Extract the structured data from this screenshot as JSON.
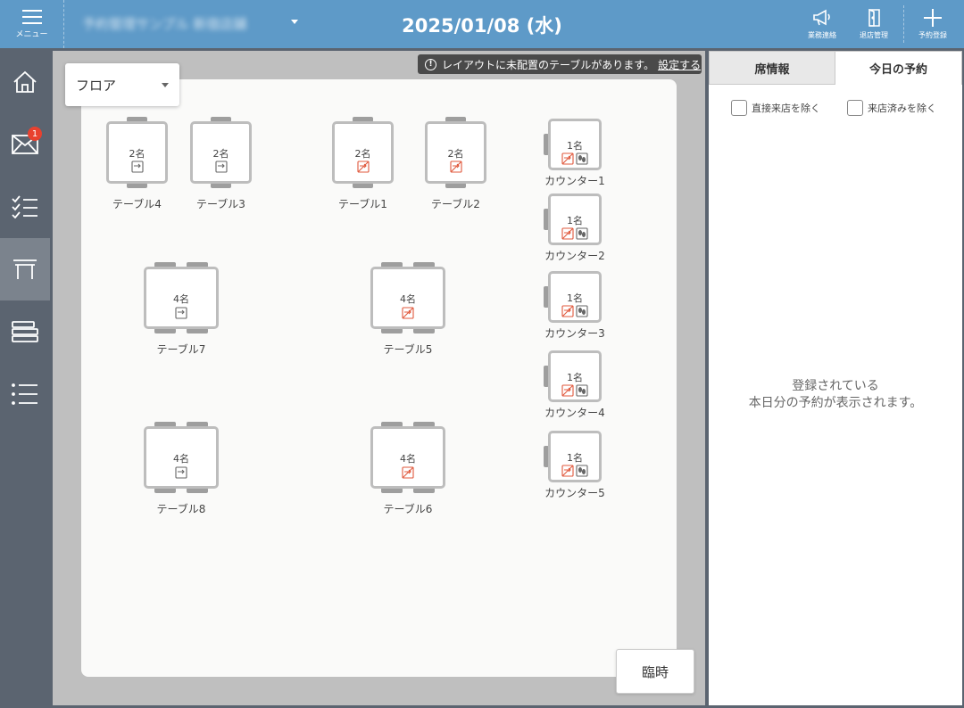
{
  "header": {
    "menu_label": "メニュー",
    "shop_name": "予約管理サンプル 新宿店舗",
    "date_title": "2025/01/08 (水)",
    "actions": [
      {
        "icon": "megaphone-icon",
        "label": "業務連絡"
      },
      {
        "icon": "exit-door-icon",
        "label": "退店管理"
      },
      {
        "icon": "plus-icon",
        "label": "予約登録"
      }
    ]
  },
  "sidebar": {
    "items": [
      {
        "icon": "home-icon"
      },
      {
        "icon": "mail-icon",
        "badge": "1"
      },
      {
        "icon": "checklist-icon"
      },
      {
        "icon": "table-icon",
        "active": true
      },
      {
        "icon": "layout-rows-icon"
      },
      {
        "icon": "list-icon"
      }
    ]
  },
  "floor": {
    "select_label": "フロア",
    "notice": "レイアウトに未配置のテーブルがあります。",
    "notice_link": "設定する",
    "temp_button": "臨時",
    "tables": [
      {
        "name": "テーブル4",
        "capacity": "2名",
        "kind": "t2",
        "icons": [
          "reserve"
        ]
      },
      {
        "name": "テーブル3",
        "capacity": "2名",
        "kind": "t2",
        "icons": [
          "reserve"
        ]
      },
      {
        "name": "テーブル1",
        "capacity": "2名",
        "kind": "t2",
        "icons": [
          "nores"
        ]
      },
      {
        "name": "テーブル2",
        "capacity": "2名",
        "kind": "t2",
        "icons": [
          "nores"
        ]
      },
      {
        "name": "カウンター1",
        "capacity": "1名",
        "kind": "counter",
        "icons": [
          "nores",
          "walkin"
        ]
      },
      {
        "name": "カウンター2",
        "capacity": "1名",
        "kind": "counter",
        "icons": [
          "nores",
          "walkin"
        ]
      },
      {
        "name": "テーブル7",
        "capacity": "4名",
        "kind": "t4",
        "icons": [
          "reserve"
        ]
      },
      {
        "name": "テーブル5",
        "capacity": "4名",
        "kind": "t4",
        "icons": [
          "nores"
        ]
      },
      {
        "name": "カウンター3",
        "capacity": "1名",
        "kind": "counter",
        "icons": [
          "nores",
          "walkin"
        ]
      },
      {
        "name": "カウンター4",
        "capacity": "1名",
        "kind": "counter",
        "icons": [
          "nores",
          "walkin"
        ]
      },
      {
        "name": "テーブル8",
        "capacity": "4名",
        "kind": "t4",
        "icons": [
          "reserve"
        ]
      },
      {
        "name": "テーブル6",
        "capacity": "4名",
        "kind": "t4",
        "icons": [
          "nores"
        ]
      },
      {
        "name": "カウンター5",
        "capacity": "1名",
        "kind": "counter",
        "icons": [
          "nores",
          "walkin"
        ]
      }
    ]
  },
  "right_panel": {
    "tabs": [
      {
        "label": "席情報",
        "active": false
      },
      {
        "label": "今日の予約",
        "active": true
      }
    ],
    "filters": [
      {
        "label": "直接来店を除く",
        "checked": false
      },
      {
        "label": "来店済みを除く",
        "checked": false
      }
    ],
    "empty_message_line1": "登録されている",
    "empty_message_line2": "本日分の予約が表示されます。"
  },
  "colors": {
    "header_bg": "#5e9ac8",
    "sidebar_bg": "#5b6470",
    "badge": "#e8412f",
    "no_reserve_icon": "#e0583c"
  }
}
